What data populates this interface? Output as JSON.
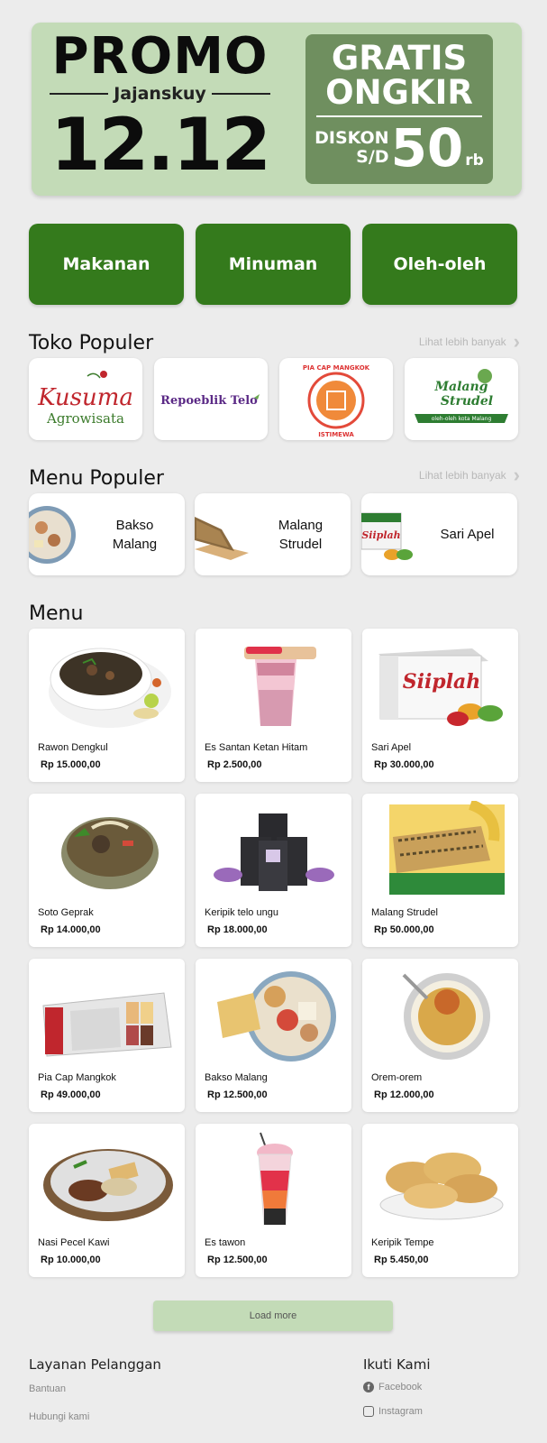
{
  "banner": {
    "promo": "PROMO",
    "brand": "Jajanskuy",
    "date": "12.12",
    "free_line1": "GRATIS",
    "free_line2": "ONGKIR",
    "discount_label1": "DISKON",
    "discount_label2": "S/D",
    "discount_amount": "50",
    "discount_unit": "rb"
  },
  "categories": [
    "Makanan",
    "Minuman",
    "Oleh-oleh"
  ],
  "popular_stores": {
    "title": "Toko Populer",
    "see_more": "Lihat lebih banyak",
    "stores": [
      {
        "logo_text1": "Kusuma",
        "logo_text2": "Agrowisata"
      },
      {
        "logo_text1": "Repoeblik Telo"
      },
      {
        "logo_text1": "PIA CAP MANGKOK",
        "logo_text2": "ISTIMEWA"
      },
      {
        "logo_text1": "Malang",
        "logo_text2": "Strudel",
        "logo_text3": "oleh-oleh kota Malang"
      }
    ]
  },
  "popular_menu": {
    "title": "Menu Populer",
    "see_more": "Lihat lebih banyak",
    "items": [
      {
        "name": "Bakso Malang",
        "icon": "meatball-soup-icon"
      },
      {
        "name": "Malang Strudel",
        "icon": "strudel-icon"
      },
      {
        "name": "Sari Apel",
        "icon": "juice-box-icon"
      }
    ]
  },
  "menu": {
    "title": "Menu",
    "items": [
      {
        "name": "Rawon Dengkul",
        "price": "Rp 15.000,00"
      },
      {
        "name": "Es Santan Ketan Hitam",
        "price": "Rp 2.500,00"
      },
      {
        "name": "Sari Apel",
        "price": "Rp 30.000,00"
      },
      {
        "name": "Soto Geprak",
        "price": "Rp 14.000,00"
      },
      {
        "name": "Keripik telo ungu",
        "price": "Rp 18.000,00"
      },
      {
        "name": "Malang Strudel",
        "price": "Rp 50.000,00"
      },
      {
        "name": "Pia Cap Mangkok",
        "price": "Rp 49.000,00"
      },
      {
        "name": "Bakso Malang",
        "price": "Rp 12.500,00"
      },
      {
        "name": "Orem-orem",
        "price": "Rp 12.000,00"
      },
      {
        "name": "Nasi Pecel Kawi",
        "price": "Rp 10.000,00"
      },
      {
        "name": "Es tawon",
        "price": "Rp 12.500,00"
      },
      {
        "name": "Keripik Tempe",
        "price": "Rp 5.450,00"
      }
    ],
    "load_more": "Load more"
  },
  "footer": {
    "customer_service_title": "Layanan Pelanggan",
    "customer_links": [
      "Bantuan",
      "Hubungi kami"
    ],
    "follow_title": "Ikuti Kami",
    "social_links": [
      {
        "label": "Facebook",
        "icon": "facebook-icon"
      },
      {
        "label": "Instagram",
        "icon": "instagram-icon"
      }
    ]
  },
  "colors": {
    "background": "#ececec",
    "banner_bg": "#c3dbb7",
    "banner_box": "#6f8f5f",
    "primary_green": "#347a1c",
    "card_bg": "#ffffff"
  }
}
